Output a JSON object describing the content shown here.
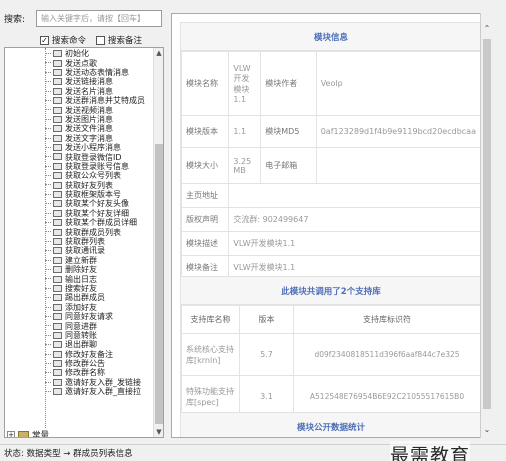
{
  "search": {
    "label": "搜索:",
    "placeholder": "输入关键字后，请按【回车】"
  },
  "options": [
    {
      "label": "搜索命令",
      "checked": true
    },
    {
      "label": "搜索备注",
      "checked": false
    }
  ],
  "tree": {
    "items": [
      "初始化",
      "发送点歌",
      "发送动态表情消息",
      "发送链接消息",
      "发送名片消息",
      "发送群消息并艾特成员",
      "发送视频消息",
      "发送图片消息",
      "发送文件消息",
      "发送文字消息",
      "发送小程序消息",
      "获取登录微信ID",
      "获取登录账号信息",
      "获取公众号列表",
      "获取好友列表",
      "获取框架版本号",
      "获取某个好友头像",
      "获取某个好友详细",
      "获取某个群成员详细",
      "获取群成员列表",
      "获取群列表",
      "获取通讯录",
      "建立新群",
      "删除好友",
      "输出日志",
      "搜索好友",
      "踢出群成员",
      "添加好友",
      "同意好友请求",
      "同意进群",
      "同意转账",
      "退出群聊",
      "修改好友备注",
      "修改群公告",
      "修改群名称",
      "邀请好友入群_发链接",
      "邀请好友入群_直接拉"
    ],
    "root_label": "常量"
  },
  "status": {
    "text": "状态: 数据类型 → 群成员列表信息"
  },
  "module_info": {
    "title": "模块信息",
    "name_label": "模块名称",
    "name_value": "VLW开发模块1.1",
    "author_label": "模块作者",
    "author_value": "Veolp",
    "version_label": "模块版本",
    "version_value": "1.1",
    "md5_label": "模块MD5",
    "md5_value": "0af123289d1f4b9e9119bcd20ecdbcaa",
    "size_label": "模块大小",
    "size_value": "3.25 MB",
    "email_label": "电子邮箱",
    "email_value": "",
    "home_label": "主页地址",
    "home_value": "",
    "copyright_label": "版权声明",
    "copyright_value": "交流群: 902499647",
    "desc_label": "模块描述",
    "desc_value": "VLW开发模块1.1",
    "note_label": "模块备注",
    "note_value": "VLW开发模块1.1"
  },
  "support_libs": {
    "title": "此模块共调用了2个支持库",
    "headers": [
      "支持库名称",
      "版本",
      "支持库标识符"
    ],
    "rows": [
      {
        "name": "系统核心支持库[krnln]",
        "version": "5.7",
        "id": "d09f2340818511d396f6aaf844c7e325"
      },
      {
        "name": "特殊功能支持库[spec]",
        "version": "3.1",
        "id": "A512548E76954B6E92C21055517615B0"
      }
    ]
  },
  "public_stats": {
    "title": "模块公开数据统计"
  },
  "watermark": "最需教育"
}
